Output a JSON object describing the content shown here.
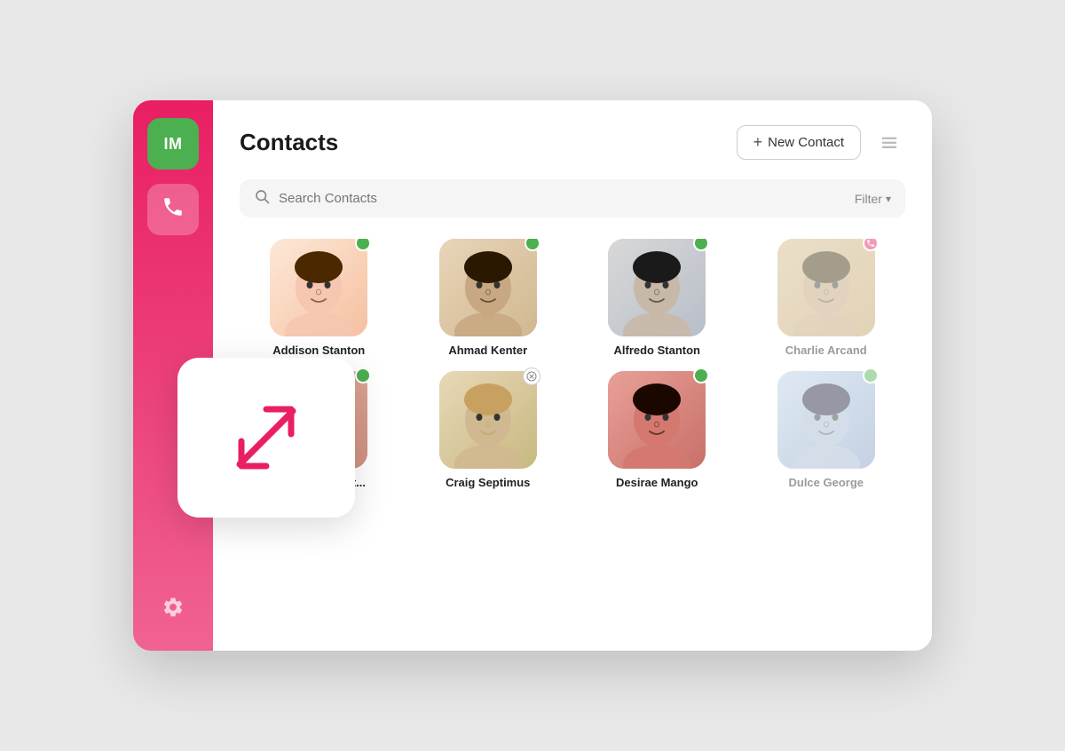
{
  "app": {
    "title": "Contacts"
  },
  "header": {
    "title": "Contacts",
    "new_contact_label": "New Contact",
    "plus_symbol": "+",
    "filter_label": "Filter"
  },
  "search": {
    "placeholder": "Search Contacts"
  },
  "sidebar": {
    "im_label": "IM",
    "phone_icon": "📞"
  },
  "contacts": {
    "row1": [
      {
        "id": "madison",
        "name": "Addison Stanton",
        "status": "online",
        "avatar_class": "avatar-madison"
      },
      {
        "id": "ahmad",
        "name": "Ahmad Kenter",
        "status": "online",
        "avatar_class": "avatar-ahmad"
      },
      {
        "id": "alfredo",
        "name": "Alfredo Stanton",
        "status": "online",
        "avatar_class": "avatar-alfredo"
      },
      {
        "id": "charlie",
        "name": "Charlie Arcand",
        "status": "call",
        "avatar_class": "avatar-charlie",
        "faded": true
      }
    ],
    "row2": [
      {
        "id": "cheyenne",
        "name": "Cheyenne Kent...",
        "status": "online",
        "avatar_class": "avatar-cheyenne"
      },
      {
        "id": "craig",
        "name": "Craig Septimus",
        "status": "busy",
        "avatar_class": "avatar-craig"
      },
      {
        "id": "desirae",
        "name": "Desirae Mango",
        "status": "online",
        "avatar_class": "avatar-desirae"
      },
      {
        "id": "dulce",
        "name": "Dulce George",
        "status": "online",
        "avatar_class": "avatar-dulce",
        "faded": true
      }
    ]
  },
  "expand_widget": {
    "label": "expand-collapse"
  }
}
